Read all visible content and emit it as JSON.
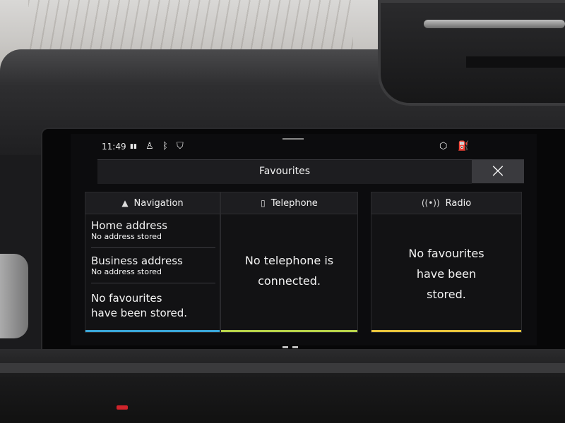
{
  "status": {
    "time": "11:49"
  },
  "header": {
    "title": "Favourites",
    "close_icon": "×"
  },
  "panels": {
    "navigation": {
      "title": "Navigation",
      "items": [
        {
          "title": "Home address",
          "subtitle": "No address stored"
        },
        {
          "title": "Business address",
          "subtitle": "No address stored"
        }
      ],
      "empty_line1": "No favourites",
      "empty_line2": "have been stored.",
      "accent": "#3aa6d8"
    },
    "telephone": {
      "title": "Telephone",
      "message_line1": "No telephone is",
      "message_line2": "connected.",
      "accent": "#b7d34a"
    },
    "radio": {
      "title": "Radio",
      "message_line1": "No favourites",
      "message_line2": "have been",
      "message_line3": "stored.",
      "accent": "#e7c43c"
    }
  },
  "icons": [
    "lte-signal-icon",
    "person-icon",
    "bluetooth-icon",
    "location-shield-icon",
    "package-icon",
    "fuel-icon",
    "navigation-arrow-icon",
    "phone-icon",
    "radio-icon",
    "close-icon"
  ]
}
